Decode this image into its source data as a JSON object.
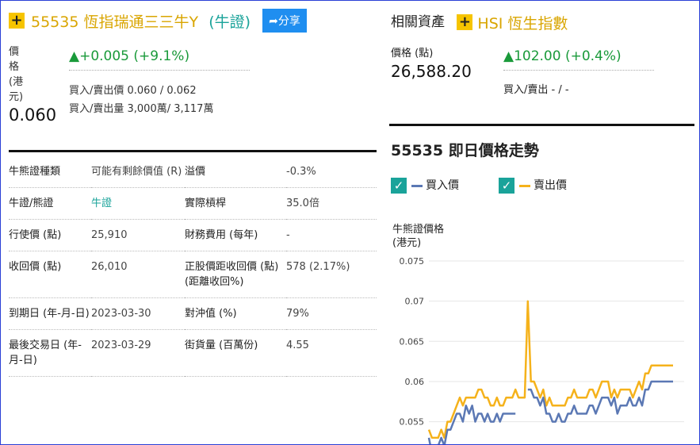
{
  "warrant": {
    "plus_symbol": "+",
    "code_name": "55535 恆指瑞通三三牛Y",
    "type_paren": "(牛證)",
    "share_label": "分享",
    "price_label_chars": [
      "價",
      "格",
      "(港",
      "元)"
    ],
    "price": "0.060",
    "change": "▲+0.005 (+9.1%)",
    "bid_ask_price": "買入/賣出價 0.060 / 0.062",
    "bid_ask_volume": "買入/賣出量 3,000萬/ 3,117萬"
  },
  "info_table": [
    {
      "k1": "牛熊證種類",
      "v1": "可能有剩餘價值 (R)",
      "k2": "溢價",
      "v2": "-0.3%"
    },
    {
      "k1": "牛證/熊證",
      "v1": "牛證",
      "k2": "實際槓桿",
      "v2": "35.0倍"
    },
    {
      "k1": "行使價 (點)",
      "v1": "25,910",
      "k2": "財務費用 (每年)",
      "v2": "-"
    },
    {
      "k1": "收回價 (點)",
      "v1": "26,010",
      "k2": "正股價距收回價 (點) (距離收回%)",
      "v2": "578 (2.17%)"
    },
    {
      "k1": "到期日 (年-月-日)",
      "v1": "2023-03-30",
      "k2": "對沖值 (%)",
      "v2": "79%"
    },
    {
      "k1": "最後交易日 (年-月-日)",
      "v1": "2023-03-29",
      "k2": "街貨量 (百萬份)",
      "v2": "4.55"
    }
  ],
  "related": {
    "heading": "相關資產",
    "plus_symbol": "+",
    "name": "HSI 恆生指數",
    "price_label": "價格 (點)",
    "price": "26,588.20",
    "change": "▲102.00 (+0.4%)",
    "bid_ask": "買入/賣出 - / -"
  },
  "chart_section": {
    "title": "55535 即日價格走勢",
    "check_symbol": "✓",
    "legend_bid": "買入價",
    "legend_ask": "賣出價",
    "y_label_line1": "牛熊證價格",
    "y_label_line2": "(港元)"
  },
  "colors": {
    "bid": "#5b78b4",
    "ask": "#f5b21b",
    "up": "#1a9a3a",
    "accent": "#d9a500",
    "teal": "#1aa39a"
  },
  "chart_data": {
    "type": "line",
    "ylabel": "牛熊證價格 (港元)",
    "ylim": [
      0.052,
      0.075
    ],
    "yticks": [
      "0.075",
      "0.07",
      "0.065",
      "0.06",
      "0.055"
    ],
    "series": [
      {
        "name": "買入價",
        "values": [
          0.053,
          0.051,
          0.052,
          0.052,
          0.053,
          0.052,
          0.054,
          0.054,
          0.055,
          0.056,
          0.056,
          0.055,
          0.057,
          0.056,
          0.057,
          0.055,
          0.056,
          0.056,
          0.055,
          0.056,
          0.055,
          0.055,
          0.056,
          0.055,
          0.056,
          0.056,
          0.056,
          0.056,
          0.056,
          null,
          null,
          null,
          0.059,
          0.059,
          0.058,
          0.058,
          0.057,
          0.058,
          0.056,
          0.056,
          0.055,
          0.055,
          0.056,
          0.055,
          0.055,
          0.056,
          0.056,
          0.057,
          0.056,
          0.056,
          0.056,
          0.056,
          0.057,
          0.057,
          0.056,
          0.057,
          0.058,
          0.058,
          0.058,
          0.057,
          0.058,
          0.056,
          0.057,
          0.057,
          0.057,
          0.058,
          0.057,
          0.057,
          0.058,
          0.057,
          0.059,
          0.059,
          0.06,
          0.06,
          0.06,
          0.06,
          0.06,
          0.06,
          0.06,
          0.06
        ]
      },
      {
        "name": "賣出價",
        "values": [
          0.054,
          0.053,
          0.053,
          0.053,
          0.054,
          0.053,
          0.055,
          0.055,
          0.056,
          0.057,
          0.058,
          0.057,
          0.058,
          0.058,
          0.058,
          0.058,
          0.059,
          0.059,
          0.058,
          0.058,
          0.057,
          0.057,
          0.058,
          0.057,
          0.057,
          0.058,
          0.058,
          0.058,
          0.059,
          0.058,
          0.058,
          0.058,
          0.07,
          0.06,
          0.06,
          0.059,
          0.058,
          0.059,
          0.057,
          0.058,
          0.057,
          0.057,
          0.057,
          0.057,
          0.057,
          0.058,
          0.058,
          0.059,
          0.058,
          0.058,
          0.058,
          0.058,
          0.059,
          0.059,
          0.058,
          0.059,
          0.06,
          0.06,
          0.06,
          0.058,
          0.059,
          0.058,
          0.059,
          0.059,
          0.059,
          0.059,
          0.058,
          0.059,
          0.06,
          0.059,
          0.061,
          0.061,
          0.062,
          0.062,
          0.062,
          0.062,
          0.062,
          0.062,
          0.062,
          0.062
        ]
      }
    ]
  }
}
